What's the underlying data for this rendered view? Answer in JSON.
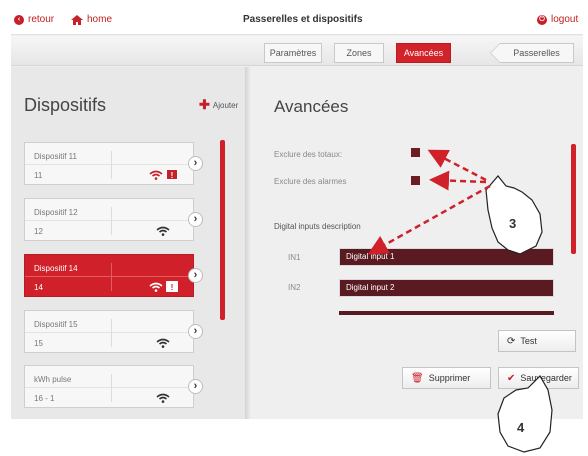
{
  "topbar": {
    "back_label": "retour",
    "home_label": "home",
    "title": "Passerelles et dispositifs",
    "logout_label": "logout"
  },
  "tabs": [
    {
      "label": "Paramètres",
      "active": false
    },
    {
      "label": "Zones",
      "active": false
    },
    {
      "label": "Avancées",
      "active": true
    }
  ],
  "gateways_label": "Passerelles",
  "sidebar": {
    "title": "Dispositifs",
    "add_label": "Ajouter",
    "devices": [
      {
        "name": "Dispositif 11",
        "sub": "11",
        "alarm": true,
        "active": false
      },
      {
        "name": "Dispositif 12",
        "sub": "12",
        "alarm": false,
        "active": false
      },
      {
        "name": "Dispositif 14",
        "sub": "14",
        "alarm": true,
        "active": true
      },
      {
        "name": "Dispositif 15",
        "sub": "15",
        "alarm": false,
        "active": false
      },
      {
        "name": "kWh pulse",
        "sub": "16 - 1",
        "alarm": false,
        "active": false
      }
    ],
    "alarm_glyph": "!"
  },
  "main": {
    "title": "Avancées",
    "exclude_totals_label": "Exclure des totaux:",
    "exclude_alarms_label": "Exclure des alarmes",
    "digital_section_label": "Digital inputs description",
    "inputs": [
      {
        "label": "IN1",
        "value": "Digital input 1"
      },
      {
        "label": "IN2",
        "value": "Digital input 2"
      }
    ]
  },
  "buttons": {
    "test_label": "Test",
    "delete_label": "Supprimer",
    "save_label": "Sauvegarder"
  },
  "annotations": {
    "callout_3": "3",
    "callout_4": "4"
  },
  "colors": {
    "accent": "#d0202a",
    "dark_red": "#5a1a21",
    "background": "#efefef"
  },
  "icons": {
    "back": "arrow-left-circle-icon",
    "home": "home-icon",
    "logout": "power-icon",
    "add": "plus-icon",
    "signal": "wifi-icon",
    "alarm": "alert-icon",
    "test": "refresh-icon",
    "delete": "trash-icon",
    "save": "check-icon"
  }
}
